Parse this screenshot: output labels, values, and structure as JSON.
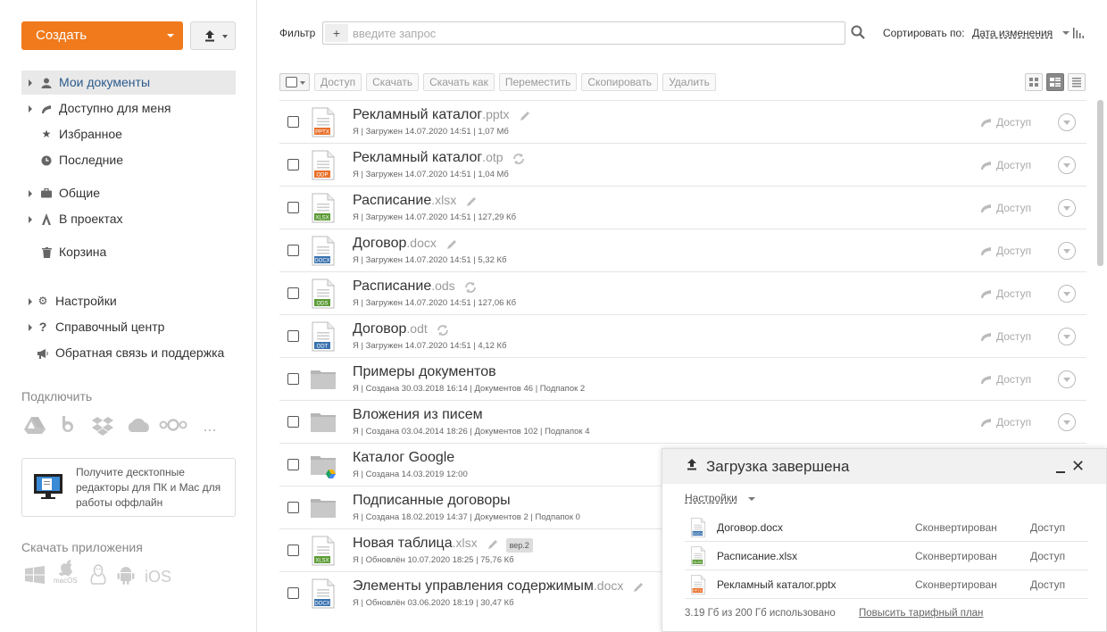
{
  "sidebar": {
    "create_label": "Создать",
    "nav": [
      {
        "label": "Мои документы"
      },
      {
        "label": "Доступно для меня"
      },
      {
        "label": "Избранное"
      },
      {
        "label": "Последние"
      },
      {
        "label": "Общие"
      },
      {
        "label": "В проектах"
      },
      {
        "label": "Корзина"
      },
      {
        "label": "Настройки"
      },
      {
        "label": "Справочный центр"
      },
      {
        "label": "Обратная связь и поддержка"
      }
    ],
    "connect_title": "Подключить",
    "services": [
      "google-drive-icon",
      "box-icon",
      "dropbox-icon",
      "onedrive-icon",
      "nextcloud-icon",
      "more-icon"
    ],
    "more_label": "...",
    "promo_text": "Получите десктопные редакторы для ПК и Mac для работы оффлайн",
    "apps_title": "Скачать приложения",
    "apps": {
      "macos": "macOS",
      "ios": "iOS"
    }
  },
  "filter": {
    "label": "Фильтр",
    "placeholder": "введите запрос"
  },
  "sort": {
    "label": "Сортировать по:",
    "value": "Дата изменения"
  },
  "toolbar": {
    "buttons": [
      "Доступ",
      "Скачать",
      "Скачать как",
      "Переместить",
      "Скопировать",
      "Удалить"
    ]
  },
  "files": [
    {
      "name": "Рекламный каталог",
      "ext": ".pptx",
      "type": "PPTX",
      "color": "#e8702a",
      "meta": "Я | Загружен 14.07.2020 14:51 | 1,07 Мб",
      "extra": "edit"
    },
    {
      "name": "Рекламный каталог",
      "ext": ".otp",
      "type": "ODP",
      "color": "#e8702a",
      "meta": "Я | Загружен 14.07.2020 14:51 | 1,04 Мб",
      "extra": "convert"
    },
    {
      "name": "Расписание",
      "ext": ".xlsx",
      "type": "XLSX",
      "color": "#5b9b35",
      "meta": "Я | Загружен 14.07.2020 14:51 | 127,29 Кб",
      "extra": "edit"
    },
    {
      "name": "Договор",
      "ext": ".docx",
      "type": "DOCX",
      "color": "#3b73b0",
      "meta": "Я | Загружен 14.07.2020 14:51 | 5,32 Кб",
      "extra": "edit"
    },
    {
      "name": "Расписание",
      "ext": ".ods",
      "type": "ODS",
      "color": "#5b9b35",
      "meta": "Я | Загружен 14.07.2020 14:51 | 127,06 Кб",
      "extra": "convert"
    },
    {
      "name": "Договор",
      "ext": ".odt",
      "type": "ODT",
      "color": "#3b73b0",
      "meta": "Я | Загружен 14.07.2020 14:51 | 4,12 Кб",
      "extra": "convert"
    },
    {
      "name": "Примеры документов",
      "ext": "",
      "type": "folder",
      "meta": "Я | Создана 30.03.2018 16:14 | Документов 46 | Подпапок 2",
      "extra": ""
    },
    {
      "name": "Вложения из писем",
      "ext": "",
      "type": "folder",
      "meta": "Я | Создана 03.04.2014 18:26 | Документов 102 | Подпапок 4",
      "extra": ""
    },
    {
      "name": "Каталог Google",
      "ext": "",
      "type": "gfolder",
      "meta": "Я | Создана 14.03.2019 12:00",
      "extra": ""
    },
    {
      "name": "Подписанные договоры",
      "ext": "",
      "type": "folder",
      "meta": "Я | Создана 18.02.2019 14:37 | Документов 2 | Подпапок 0",
      "extra": ""
    },
    {
      "name": "Новая таблица",
      "ext": ".xlsx",
      "type": "XLSX",
      "color": "#5b9b35",
      "meta": "Я | Обновлён 10.07.2020 18:25 | 75,76 Кб",
      "extra": "edit",
      "version": "вер.2"
    },
    {
      "name": "Элементы управления содержимым",
      "ext": ".docx",
      "type": "DOCX",
      "color": "#3b73b0",
      "meta": "Я | Обновлён 03.06.2020 18:19 | 30,47 Кб",
      "extra": "edit"
    }
  ],
  "share_label": "Доступ",
  "visible_share_rows": 8,
  "upload_panel": {
    "title": "Загрузка завершена",
    "settings_label": "Настройки",
    "items": [
      {
        "name": "Договор.docx",
        "type": "DOCX",
        "color": "#3b73b0",
        "status": "Сконвертирован",
        "action": "Доступ"
      },
      {
        "name": "Расписание.xlsx",
        "type": "XLSX",
        "color": "#5b9b35",
        "status": "Сконвертирован",
        "action": "Доступ"
      },
      {
        "name": "Рекламный каталог.pptx",
        "type": "PPTX",
        "color": "#e8702a",
        "status": "Сконвертирован",
        "action": "Доступ"
      }
    ],
    "usage": "3.19 Гб из 200 Гб использовано",
    "upgrade_label": "Повысить тарифный план"
  },
  "colors": {
    "accent": "#f07a1c",
    "active_nav": "#2c5b8c"
  }
}
